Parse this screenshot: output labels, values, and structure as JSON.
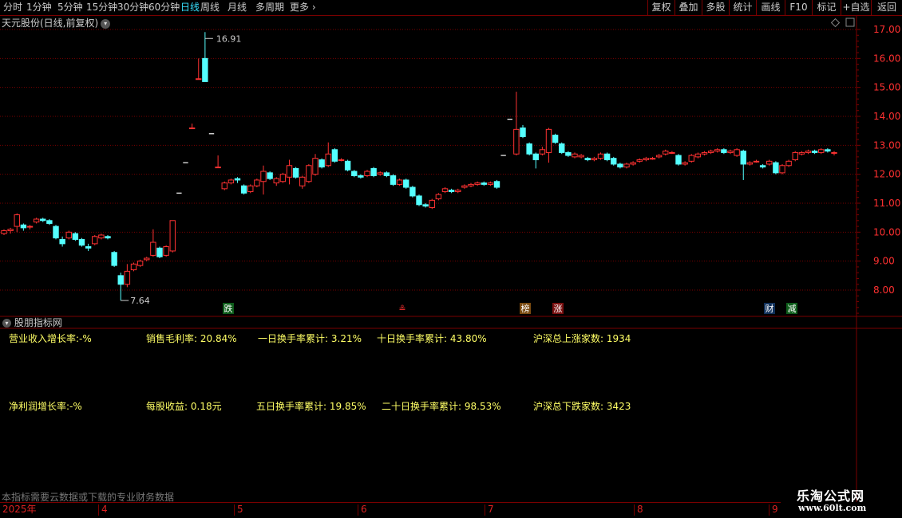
{
  "toolbar": {
    "periods": [
      "分时",
      "1分钟",
      "5分钟",
      "15分钟",
      "30分钟",
      "60分钟",
      "日线",
      "周线",
      "月线",
      "多周期",
      "更多"
    ],
    "buttons": [
      "复权",
      "叠加",
      "多股",
      "统计",
      "画线",
      "F10",
      "标记",
      "+自选",
      "返回"
    ]
  },
  "chart": {
    "title": "天元股份(日线,前复权)",
    "price_labels": [
      "17.00",
      "16.00",
      "15.00",
      "14.00",
      "13.00",
      "12.00",
      "11.00",
      "10.00",
      "9.00",
      "8.00"
    ],
    "high_label": "16.91",
    "low_label": "7.64",
    "markers": [
      {
        "text": "跌",
        "color": "#0d5c1a",
        "fg": "#ffffff"
      },
      {
        "text": "≗",
        "color": "#000000",
        "fg": "#ff3030"
      },
      {
        "text": "榜",
        "color": "#7a4a10",
        "fg": "#ffffff"
      },
      {
        "text": "涨",
        "color": "#7a1010",
        "fg": "#ffffff"
      },
      {
        "text": "财",
        "color": "#10305a",
        "fg": "#ffffff"
      },
      {
        "text": "减",
        "color": "#0d5c1a",
        "fg": "#ffffff"
      }
    ]
  },
  "chart_data": {
    "type": "candlestick",
    "title": "天元股份(日线,前复权)",
    "ylim": [
      7.3,
      17.3
    ],
    "x_ticks": [
      "2025年",
      "4",
      "5",
      "6",
      "7",
      "8",
      "9"
    ],
    "annotations": {
      "high": 16.91,
      "low": 7.64
    },
    "candles": [
      [
        9.95,
        10.05,
        10.1,
        9.9
      ],
      [
        10.05,
        10.1,
        10.15,
        9.95
      ],
      [
        10.2,
        10.6,
        10.65,
        10.0
      ],
      [
        10.25,
        10.15,
        10.3,
        10.05
      ],
      [
        10.2,
        10.2,
        10.25,
        10.1
      ],
      [
        10.35,
        10.45,
        10.5,
        10.3
      ],
      [
        10.45,
        10.4,
        10.5,
        10.35
      ],
      [
        10.4,
        10.3,
        10.45,
        10.25
      ],
      [
        10.2,
        9.8,
        10.25,
        9.75
      ],
      [
        9.75,
        9.6,
        9.85,
        9.5
      ],
      [
        9.8,
        10.0,
        10.05,
        9.75
      ],
      [
        9.95,
        9.75,
        10.0,
        9.7
      ],
      [
        9.75,
        9.55,
        9.8,
        9.5
      ],
      [
        9.5,
        9.45,
        9.6,
        9.35
      ],
      [
        9.6,
        9.85,
        9.9,
        9.55
      ],
      [
        9.8,
        9.9,
        9.95,
        9.75
      ],
      [
        9.85,
        9.8,
        9.9,
        9.75
      ],
      [
        9.3,
        8.85,
        9.35,
        8.8
      ],
      [
        8.5,
        8.2,
        8.6,
        7.64
      ],
      [
        8.2,
        8.65,
        8.9,
        8.1
      ],
      [
        8.7,
        8.9,
        8.95,
        8.65
      ],
      [
        8.85,
        9.0,
        9.05,
        8.8
      ],
      [
        9.05,
        9.1,
        9.15,
        9.0
      ],
      [
        9.2,
        9.65,
        10.1,
        9.15
      ],
      [
        9.45,
        9.15,
        9.5,
        9.1
      ],
      [
        9.2,
        9.5,
        9.55,
        9.15
      ],
      [
        9.35,
        10.4,
        10.4,
        9.3
      ],
      [
        11.35,
        11.35,
        11.35,
        11.35
      ],
      [
        12.4,
        12.4,
        12.4,
        12.4
      ],
      [
        13.6,
        13.6,
        13.75,
        13.6
      ],
      [
        15.3,
        15.3,
        16.0,
        15.3
      ],
      [
        16.0,
        15.2,
        16.91,
        15.2
      ],
      [
        13.4,
        13.4,
        13.4,
        13.4
      ],
      [
        12.25,
        12.25,
        12.65,
        12.25
      ],
      [
        11.5,
        11.7,
        11.75,
        11.45
      ],
      [
        11.7,
        11.8,
        11.85,
        11.65
      ],
      [
        11.85,
        11.8,
        11.9,
        11.7
      ],
      [
        11.6,
        11.35,
        11.65,
        11.3
      ],
      [
        11.4,
        11.6,
        11.65,
        11.35
      ],
      [
        11.6,
        11.8,
        11.85,
        11.55
      ],
      [
        11.75,
        12.1,
        12.3,
        11.3
      ],
      [
        12.05,
        11.85,
        12.1,
        11.8
      ],
      [
        11.7,
        11.85,
        11.9,
        11.6
      ],
      [
        11.75,
        12.0,
        12.05,
        11.7
      ],
      [
        11.9,
        12.3,
        12.5,
        11.65
      ],
      [
        12.2,
        11.9,
        12.25,
        11.85
      ],
      [
        11.6,
        11.9,
        11.95,
        11.5
      ],
      [
        11.75,
        12.3,
        12.35,
        11.7
      ],
      [
        12.0,
        12.55,
        12.7,
        11.95
      ],
      [
        12.5,
        12.25,
        12.55,
        12.2
      ],
      [
        12.3,
        12.7,
        13.1,
        12.25
      ],
      [
        12.85,
        12.45,
        12.9,
        12.4
      ],
      [
        12.5,
        12.5,
        12.55,
        12.45
      ],
      [
        12.45,
        12.15,
        12.5,
        12.1
      ],
      [
        12.1,
        11.95,
        12.15,
        11.9
      ],
      [
        11.95,
        11.9,
        12.0,
        11.85
      ],
      [
        11.95,
        12.1,
        12.15,
        11.9
      ],
      [
        12.2,
        11.95,
        12.25,
        11.9
      ],
      [
        12.0,
        12.05,
        12.1,
        11.95
      ],
      [
        12.05,
        11.95,
        12.1,
        11.9
      ],
      [
        11.95,
        11.65,
        12.0,
        11.6
      ],
      [
        11.65,
        11.8,
        11.85,
        11.6
      ],
      [
        11.8,
        11.55,
        11.85,
        11.5
      ],
      [
        11.55,
        11.25,
        11.6,
        11.2
      ],
      [
        11.25,
        10.95,
        11.3,
        10.9
      ],
      [
        10.95,
        10.9,
        11.0,
        10.85
      ],
      [
        10.85,
        11.1,
        11.15,
        10.8
      ],
      [
        11.15,
        11.3,
        11.35,
        11.1
      ],
      [
        11.4,
        11.5,
        11.55,
        11.35
      ],
      [
        11.45,
        11.4,
        11.5,
        11.35
      ],
      [
        11.4,
        11.45,
        11.5,
        11.35
      ],
      [
        11.55,
        11.6,
        11.65,
        11.5
      ],
      [
        11.6,
        11.65,
        11.7,
        11.55
      ],
      [
        11.65,
        11.7,
        11.75,
        11.6
      ],
      [
        11.7,
        11.65,
        11.75,
        11.6
      ],
      [
        11.65,
        11.7,
        11.75,
        11.6
      ],
      [
        11.75,
        11.55,
        11.8,
        11.5
      ],
      [
        12.65,
        12.65,
        12.65,
        12.65
      ],
      [
        13.9,
        13.9,
        13.9,
        13.9
      ],
      [
        12.7,
        13.55,
        14.85,
        12.65
      ],
      [
        13.6,
        13.3,
        13.7,
        13.25
      ],
      [
        13.05,
        12.7,
        13.1,
        12.65
      ],
      [
        12.7,
        12.5,
        12.75,
        12.2
      ],
      [
        12.7,
        12.85,
        12.95,
        12.65
      ],
      [
        12.75,
        13.55,
        13.6,
        12.4
      ],
      [
        13.35,
        13.1,
        13.4,
        13.05
      ],
      [
        13.05,
        12.75,
        13.1,
        12.7
      ],
      [
        12.75,
        12.65,
        12.8,
        12.6
      ],
      [
        12.6,
        12.7,
        12.75,
        12.55
      ],
      [
        12.6,
        12.65,
        12.7,
        12.55
      ],
      [
        12.55,
        12.5,
        12.6,
        12.45
      ],
      [
        12.5,
        12.55,
        12.6,
        12.45
      ],
      [
        12.55,
        12.7,
        12.75,
        12.5
      ],
      [
        12.7,
        12.5,
        12.75,
        12.45
      ],
      [
        12.55,
        12.35,
        12.6,
        12.3
      ],
      [
        12.35,
        12.25,
        12.4,
        12.2
      ],
      [
        12.25,
        12.35,
        12.4,
        12.2
      ],
      [
        12.35,
        12.4,
        12.45,
        12.3
      ],
      [
        12.45,
        12.5,
        12.55,
        12.4
      ],
      [
        12.5,
        12.55,
        12.6,
        12.45
      ],
      [
        12.55,
        12.55,
        12.6,
        12.5
      ],
      [
        12.6,
        12.65,
        12.7,
        12.55
      ],
      [
        12.7,
        12.8,
        12.85,
        12.65
      ],
      [
        12.75,
        12.75,
        12.8,
        12.7
      ],
      [
        12.65,
        12.35,
        12.7,
        12.3
      ],
      [
        12.35,
        12.4,
        12.45,
        12.3
      ],
      [
        12.45,
        12.65,
        12.7,
        12.4
      ],
      [
        12.6,
        12.7,
        12.75,
        12.55
      ],
      [
        12.7,
        12.75,
        12.8,
        12.65
      ],
      [
        12.75,
        12.8,
        12.85,
        12.7
      ],
      [
        12.8,
        12.85,
        12.9,
        12.75
      ],
      [
        12.85,
        12.75,
        12.9,
        12.7
      ],
      [
        12.75,
        12.8,
        12.85,
        12.7
      ],
      [
        12.65,
        12.85,
        12.9,
        12.6
      ],
      [
        12.8,
        12.35,
        12.85,
        11.8
      ],
      [
        12.35,
        12.4,
        12.45,
        12.3
      ],
      [
        12.45,
        12.45,
        12.5,
        12.4
      ],
      [
        12.3,
        12.25,
        12.35,
        12.2
      ],
      [
        12.35,
        12.45,
        12.5,
        12.3
      ],
      [
        12.4,
        12.05,
        12.45,
        12.0
      ],
      [
        12.05,
        12.3,
        12.35,
        12.0
      ],
      [
        12.3,
        12.45,
        12.5,
        12.25
      ],
      [
        12.5,
        12.75,
        12.8,
        12.45
      ],
      [
        12.7,
        12.75,
        12.8,
        12.65
      ],
      [
        12.75,
        12.8,
        12.85,
        12.7
      ],
      [
        12.8,
        12.75,
        12.85,
        12.7
      ],
      [
        12.75,
        12.85,
        12.9,
        12.7
      ],
      [
        12.85,
        12.8,
        12.9,
        12.75
      ],
      [
        12.75,
        12.75,
        12.8,
        12.65
      ]
    ]
  },
  "subchart": {
    "title": "股朋指标网",
    "items": [
      {
        "label": "营业收入增长率:",
        "value": "-%"
      },
      {
        "label": "销售毛利率:",
        "value": "20.84%"
      },
      {
        "label": "一日换手率累计:",
        "value": "3.21%"
      },
      {
        "label": "十日换手率累计:",
        "value": "43.80%"
      },
      {
        "label": "沪深总上涨家数:",
        "value": "1934"
      },
      {
        "label": "净利润增长率:",
        "value": "-%"
      },
      {
        "label": "每股收益:",
        "value": "0.18元"
      },
      {
        "label": "五日换手率累计:",
        "value": "19.85%"
      },
      {
        "label": "二十日换手率累计:",
        "value": "98.53%"
      },
      {
        "label": "沪深总下跌家数:",
        "value": "3423"
      }
    ],
    "note": "本指标需要云数据或下载的专业财务数据"
  },
  "time_axis": [
    "2025年",
    "4",
    "5",
    "6",
    "7",
    "8",
    "9"
  ],
  "watermark": {
    "line1": "乐淘公式网",
    "line2": "www.60lt.com"
  },
  "colors": {
    "up": "#ff3232",
    "down": "#54ffff",
    "grid": "#7a0000",
    "axis_text": "#ff3030",
    "indicator": "#ffff66"
  }
}
